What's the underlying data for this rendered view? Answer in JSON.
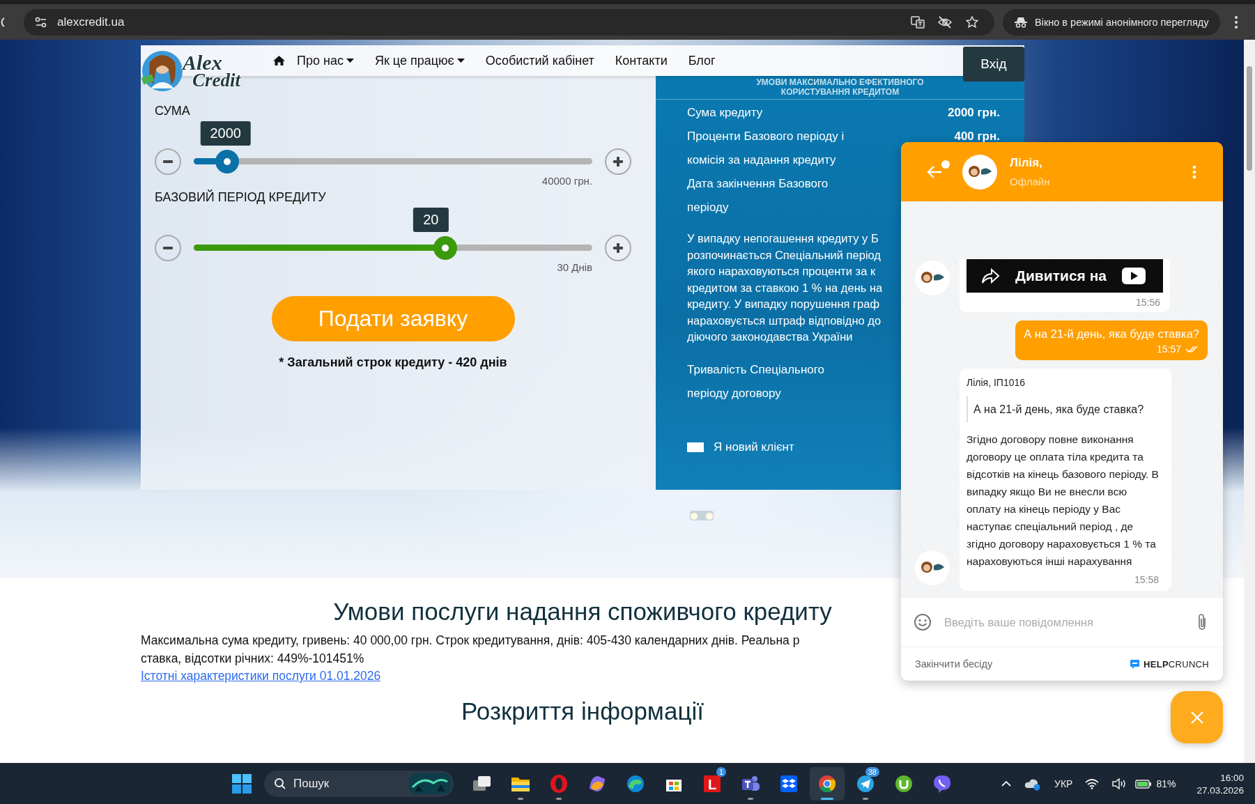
{
  "browser": {
    "url": "alexcredit.ua",
    "incognito_label": "Вікно в режимі анонімного перегляду"
  },
  "nav": {
    "logo_text": [
      "Alex",
      "Credit"
    ],
    "items": [
      {
        "label": "Про нас",
        "dropdown": true
      },
      {
        "label": "Як це працює",
        "dropdown": true
      },
      {
        "label": "Особистий кабінет",
        "dropdown": false
      },
      {
        "label": "Контакти",
        "dropdown": false
      },
      {
        "label": "Блог",
        "dropdown": false
      }
    ],
    "login": "Вхід"
  },
  "calculator": {
    "sliders": [
      {
        "label": "СУМА",
        "value": "2000",
        "max_label": "40000 грн.",
        "level": 0.08,
        "color": "#0a72a8"
      },
      {
        "label": "БАЗОВИЙ ПЕРІОД КРЕДИТУ",
        "value": "20",
        "max_label": "30 Днів",
        "level": 0.595,
        "color": "#3a9a0c"
      }
    ],
    "submit": "Подати заявку",
    "note": "* Загальний строк кредиту - 420 днів"
  },
  "terms_panel": {
    "title_lines": [
      "УМОВИ МАКСИМАЛЬНО ЕФЕКТИВНОГО",
      "КОРИСТУВАННЯ КРЕДИТОМ"
    ],
    "rows": [
      {
        "label_lines": [
          "Сума кредиту"
        ],
        "value": "2000 грн."
      },
      {
        "label_lines": [
          "Проценти Базового періоду і",
          "комісія за надання кредиту"
        ],
        "value": "400 грн."
      },
      {
        "label_lines": [
          "Дата закінчення Базового",
          "періоду"
        ]
      }
    ],
    "notice_lines": [
      "У випадку непогашення кредиту у Б",
      "розпочинається Спеціальний період",
      "якого нараховуються проценти за к",
      "кредитом за ставкою 1 % на день на",
      "кредиту. У випадку порушення граф",
      "нараховується штраф відповідно до",
      "діючого законодавства України"
    ],
    "duration_lines": [
      "Тривалість Спеціального",
      "періоду договору"
    ],
    "checkbox": {
      "label": "Я новий клієнт",
      "checked": false
    }
  },
  "conditions": {
    "title": "Умови послуги надання споживчого кредиту",
    "text_lines": [
      "Максимальна сума кредиту, гривень: 40 000,00 грн. Строк кредитування, днів: 405-430 календарних днів. Реальна р",
      "ставка, відсотки річних: 449%-101451%"
    ],
    "link": "Істотні характеристики послуги 01.01.2026"
  },
  "disclosure": {
    "title": "Розкриття інформації"
  },
  "chat": {
    "agent": "Лілія,",
    "status": "Офлайн",
    "unread_dot": true,
    "messages": [
      {
        "kind": "video",
        "action": "Дивитися на",
        "time": "15:56"
      },
      {
        "kind": "outgoing",
        "text": "А на 21-й день, яка буде ставка?",
        "time": "15:57",
        "read": true
      },
      {
        "kind": "incoming",
        "author": "Лілія, ІП1016",
        "quote": "А на 21-й день, яка буде ставка?",
        "text": "Згідно договору повне виконання договору це оплата тіла кредита та відсотків на кінець базового періоду. В випадку якщо Ви не внесли всю оплату на кінець періоду у Вас наступає спеціальний період , де згідно договору нараховується 1 % та нараховуються інші нарахування",
        "time": "15:58"
      }
    ],
    "placeholder": "Введіть ваше повідомлення",
    "end_chat": "Закінчити бесіду",
    "brand": "**HELP**CRUNCH"
  },
  "taskbar": {
    "search": "Пошук",
    "apps": [
      {
        "kind": "taskview",
        "running": false,
        "active": false
      },
      {
        "kind": "explorer",
        "running": true,
        "active": false
      },
      {
        "kind": "opera",
        "running": true,
        "active": false
      },
      {
        "kind": "copilot",
        "running": false,
        "active": false
      },
      {
        "kind": "edge",
        "running": false,
        "active": false
      },
      {
        "kind": "store",
        "running": false,
        "active": false
      },
      {
        "kind": "tile",
        "label": "L",
        "badge": "1",
        "running": false,
        "active": false
      },
      {
        "kind": "teams",
        "running": true,
        "active": false
      },
      {
        "kind": "dropbox",
        "running": false,
        "active": false
      },
      {
        "kind": "chrome",
        "running": true,
        "active": true
      },
      {
        "kind": "telegram",
        "badge": "38",
        "running": true,
        "active": false
      },
      {
        "kind": "utorrent",
        "running": false,
        "active": false
      },
      {
        "kind": "viber",
        "running": false,
        "active": false
      }
    ],
    "language": "УКР",
    "battery": "81%",
    "time": "16:00",
    "date": "27.03.2026"
  }
}
